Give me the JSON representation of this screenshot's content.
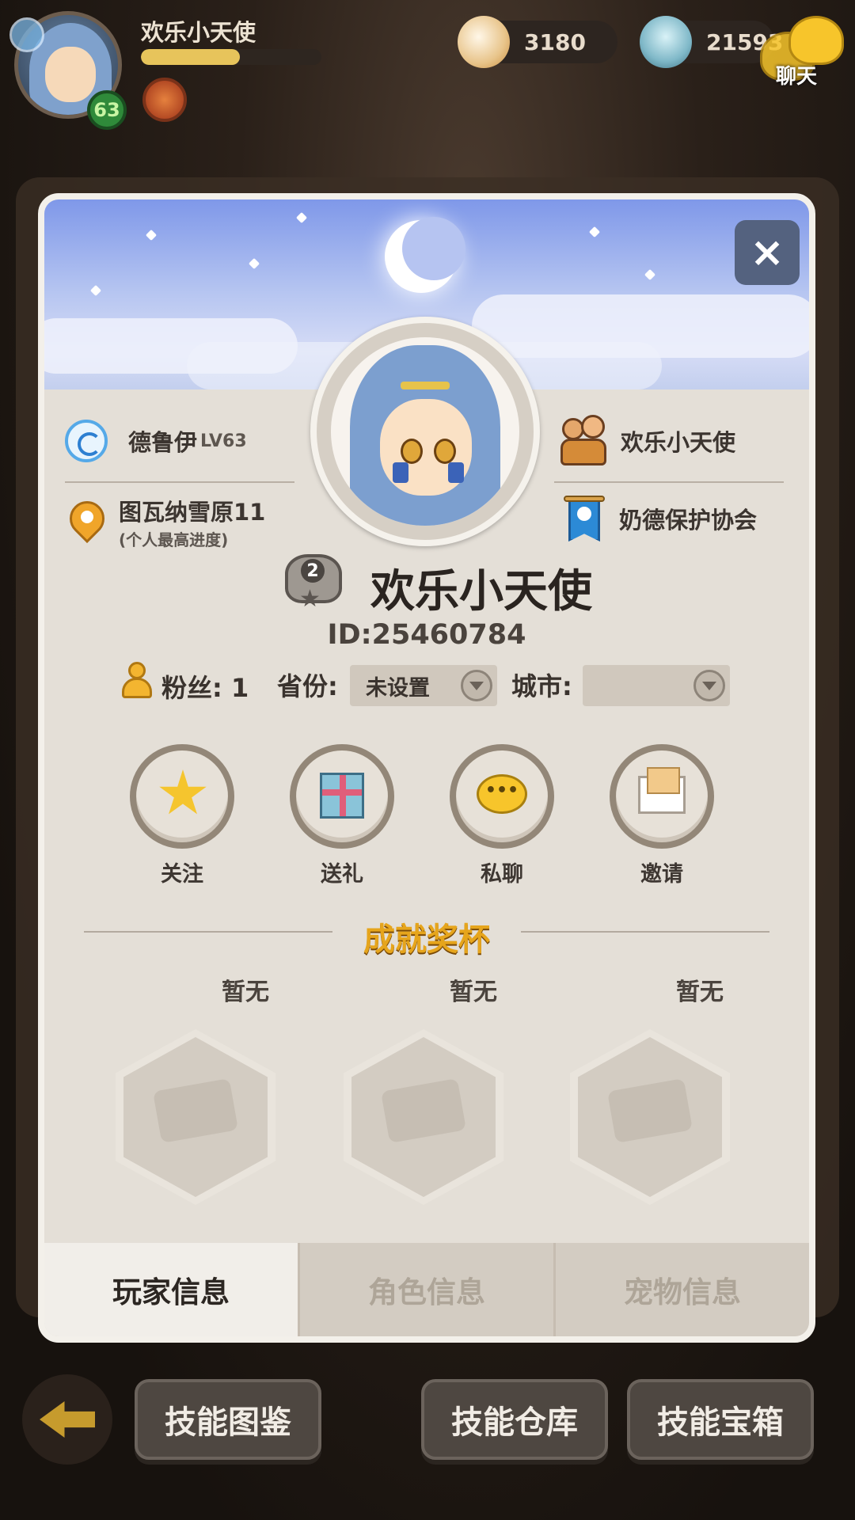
{
  "top_bar": {
    "player_name": "欢乐小天使",
    "level": "63",
    "xp_progress": 0.55,
    "currency_1": "3180",
    "currency_2": "21593",
    "chat_label": "聊天",
    "icons": [
      "class-icon",
      "level-badge",
      "fire-badge-icon",
      "pearl-shell-icon",
      "clam-shell-icon",
      "chat-bubble-icon"
    ]
  },
  "panel": {
    "close_label": "×",
    "class_name": "德鲁伊",
    "class_level": "LV63",
    "location": "图瓦纳雪原11",
    "location_note": "(个人最高进度)",
    "partner": "欢乐小天使",
    "guild": "奶德保护协会",
    "rank": "2",
    "name": "欢乐小天使",
    "id": "ID:25460784",
    "fans_label": "粉丝:",
    "fans_count": "1",
    "province_label": "省份:",
    "province_value": "未设置",
    "city_label": "城市:",
    "city_value": "",
    "actions": [
      {
        "label": "关注",
        "icon": "star-icon"
      },
      {
        "label": "送礼",
        "icon": "gift-icon"
      },
      {
        "label": "私聊",
        "icon": "chat-bubble-icon"
      },
      {
        "label": "邀请",
        "icon": "envelope-icon"
      }
    ],
    "achievement_title": "成就奖杯",
    "trophies": [
      {
        "label": "暂无"
      },
      {
        "label": "暂无"
      },
      {
        "label": "暂无"
      }
    ],
    "tabs": [
      {
        "label": "玩家信息",
        "active": true
      },
      {
        "label": "角色信息",
        "active": false
      },
      {
        "label": "宠物信息",
        "active": false
      }
    ]
  },
  "bottom_bar": {
    "buttons": [
      "技能图鉴",
      "技能仓库",
      "技能宝箱"
    ]
  },
  "colors": {
    "accent_gold": "#e6a51c",
    "panel_bg": "#e4dfd7",
    "close_btn": "#54627f"
  }
}
